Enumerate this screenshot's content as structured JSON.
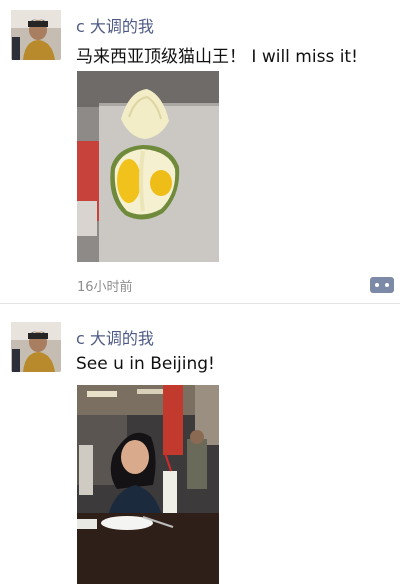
{
  "feed": {
    "posts": [
      {
        "author": "c 大调的我",
        "text": "马来西亚顶级猫山王！ I will miss it!",
        "time": "16小时前",
        "photo": "durian-photo"
      },
      {
        "author": "c 大调的我",
        "text": "See u in Beijing!",
        "photo": "restaurant-selfie-photo"
      }
    ]
  },
  "icons": {
    "comment": "comment-bubble-icon"
  },
  "colors": {
    "author_name": "#4f5b86",
    "time_text": "#8e8e8e",
    "icon": "#7d8aa7"
  }
}
